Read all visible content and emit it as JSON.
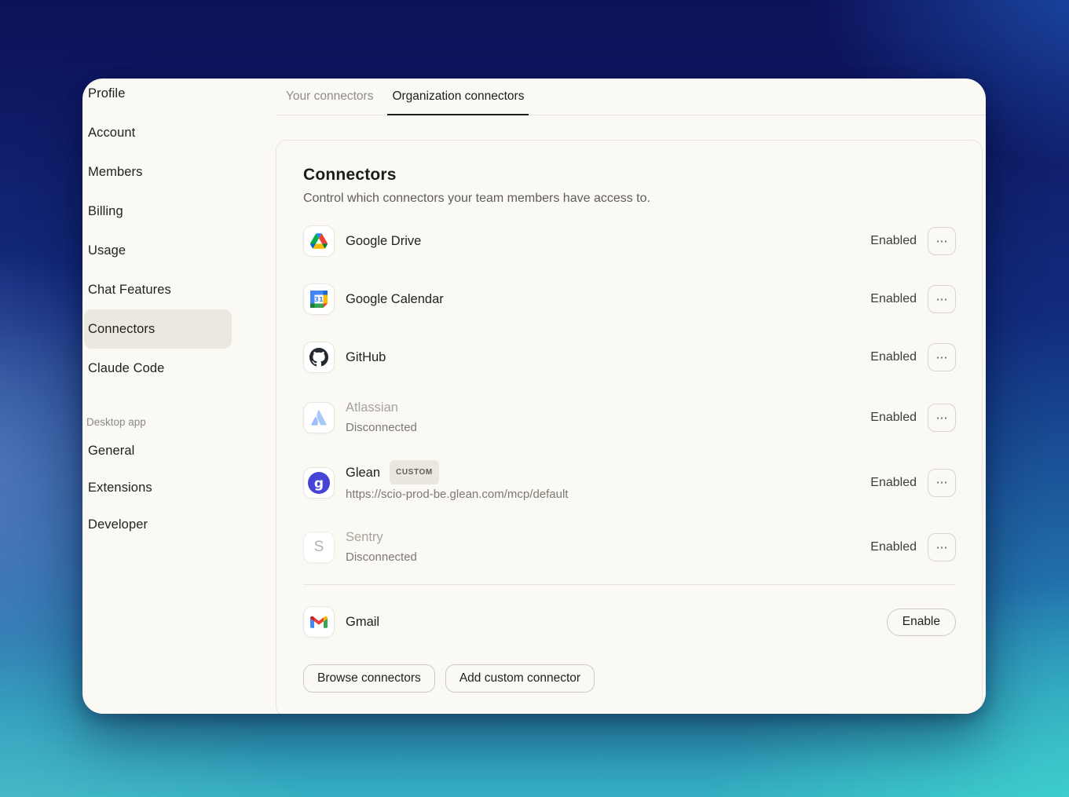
{
  "sidebar": {
    "items": [
      {
        "label": "Profile"
      },
      {
        "label": "Account"
      },
      {
        "label": "Members"
      },
      {
        "label": "Billing"
      },
      {
        "label": "Usage"
      },
      {
        "label": "Chat Features"
      },
      {
        "label": "Connectors",
        "selected": true
      },
      {
        "label": "Claude Code"
      }
    ],
    "section_label": "Desktop app",
    "desktop_items": [
      {
        "label": "General"
      },
      {
        "label": "Extensions"
      },
      {
        "label": "Developer"
      }
    ]
  },
  "tabs": {
    "your": "Your connectors",
    "organization": "Organization connectors"
  },
  "connectors": {
    "title": "Connectors",
    "subtitle": "Control which connectors your team members have access to.",
    "menu_glyph": "⋯",
    "rows": [
      {
        "name": "Google Drive",
        "status": "Enabled"
      },
      {
        "name": "Google Calendar",
        "status": "Enabled"
      },
      {
        "name": "GitHub",
        "status": "Enabled"
      },
      {
        "name": "Atlassian",
        "subtitle": "Disconnected",
        "status": "Enabled"
      },
      {
        "name": "Glean",
        "badge": "CUSTOM",
        "subtitle": "https://scio-prod-be.glean.com/mcp/default",
        "status": "Enabled"
      },
      {
        "name": "Sentry",
        "subtitle": "Disconnected",
        "status": "Enabled"
      }
    ],
    "gmail": {
      "name": "Gmail",
      "action_label": "Enable"
    },
    "footer_buttons": [
      {
        "label": "Browse connectors"
      },
      {
        "label": "Add custom connector"
      }
    ],
    "glyphs": {
      "calendar_number": "31",
      "glean_letter": "g",
      "sentry_letter": "S"
    }
  }
}
